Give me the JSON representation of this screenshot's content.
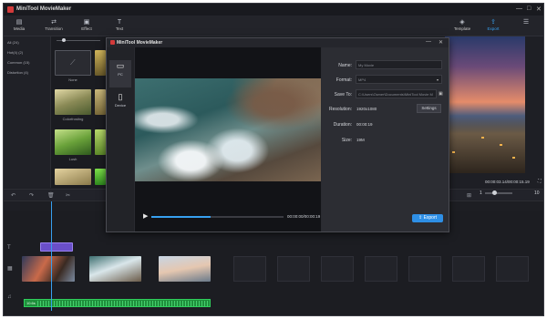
{
  "app": {
    "title": "MiniTool MovieMaker"
  },
  "toolbar": {
    "items": [
      {
        "label": "Media",
        "icon": "folder-icon"
      },
      {
        "label": "Transition",
        "icon": "transition-icon"
      },
      {
        "label": "Effect",
        "icon": "effect-icon"
      },
      {
        "label": "Text",
        "icon": "text-icon"
      },
      {
        "label": "Template",
        "icon": "template-icon"
      },
      {
        "label": "Export",
        "icon": "export-icon"
      }
    ]
  },
  "left_panel": {
    "categories": [
      "All (24)",
      "Hot(4) (2)",
      "Common (15)",
      "Distortion (4)"
    ]
  },
  "media": {
    "thumbs": [
      "None",
      "Colorfrosting",
      "Lush"
    ]
  },
  "preview": {
    "time": "00:00:03.14/00:00:15.19"
  },
  "timeline": {
    "zoom_min": "1",
    "zoom_max": "10",
    "audio_label": "10.6s",
    "audio_name": "Audio"
  },
  "dialog": {
    "title": "MiniTool MovieMaker",
    "devices": [
      {
        "label": "PC",
        "icon": "monitor-icon"
      },
      {
        "label": "Device",
        "icon": "phone-icon"
      }
    ],
    "video_time": "00:00:00/00:00:19",
    "progress": 0.45,
    "name_label": "Name:",
    "name_value": "My Movie",
    "format_label": "Format:",
    "format_value": "MP4",
    "save_label": "Save To:",
    "save_value": "C:\\Users\\Owner\\Documents\\MiniTool Movie M",
    "resolution_label": "Resolution:",
    "resolution_value": "1920x1080",
    "settings_label": "Settings",
    "duration_label": "Duration:",
    "duration_value": "00:00:19",
    "size_label": "Size:",
    "size_value": "19M",
    "export_label": "Export"
  }
}
